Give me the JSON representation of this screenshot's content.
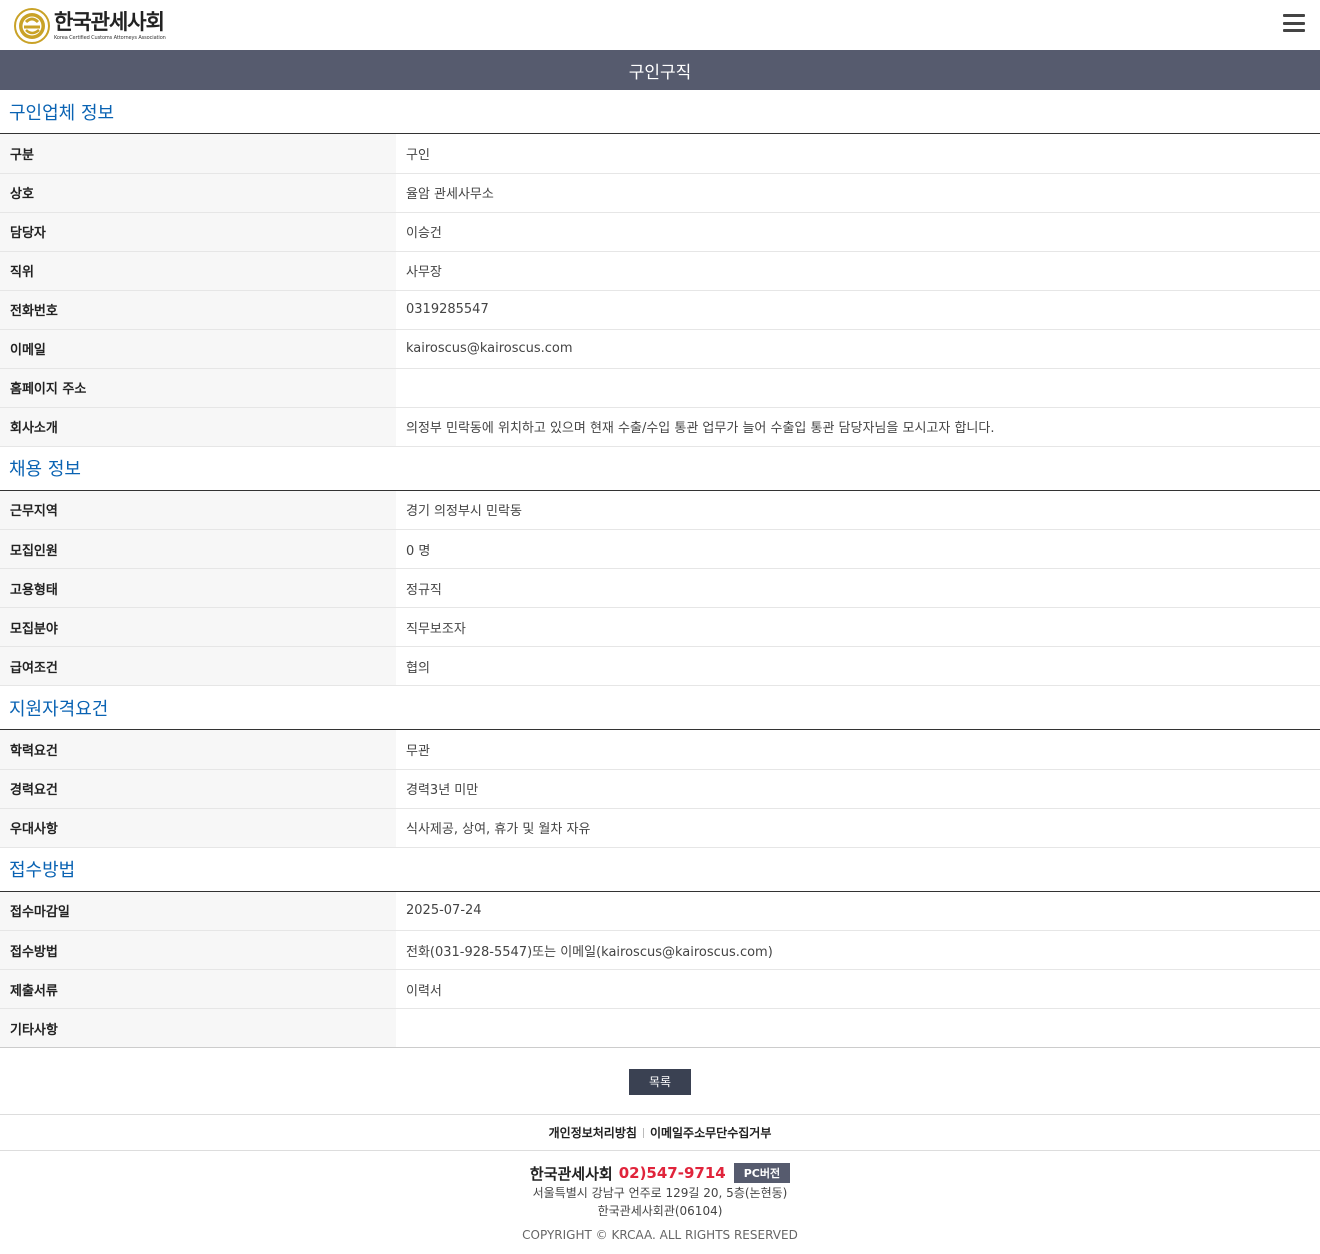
{
  "header": {
    "logo_ko": "한국관세사회",
    "logo_en": "Korea Certified Customs Attorneys Association",
    "menu_icon": "hamburger-menu-icon"
  },
  "page_title": "구인구직",
  "sections": [
    {
      "title": "구인업체 정보",
      "rows": [
        {
          "label": "구분",
          "value": "구인"
        },
        {
          "label": "상호",
          "value": "율암 관세사무소"
        },
        {
          "label": "담당자",
          "value": "이승건"
        },
        {
          "label": "직위",
          "value": "사무장"
        },
        {
          "label": "전화번호",
          "value": "0319285547"
        },
        {
          "label": "이메일",
          "value": "kairoscus@kairoscus.com"
        },
        {
          "label": "홈페이지 주소",
          "value": ""
        },
        {
          "label": "회사소개",
          "value": "의정부 민락동에 위치하고 있으며 현재 수출/수입 통관 업무가 늘어 수출입 통관 담당자님을 모시고자 합니다."
        }
      ]
    },
    {
      "title": "채용 정보",
      "rows": [
        {
          "label": "근무지역",
          "value": "경기 의정부시 민락동"
        },
        {
          "label": "모집인원",
          "value": "0 명"
        },
        {
          "label": "고용형태",
          "value": "정규직"
        },
        {
          "label": "모집분야",
          "value": "직무보조자"
        },
        {
          "label": "급여조건",
          "value": "협의"
        }
      ]
    },
    {
      "title": "지원자격요건",
      "rows": [
        {
          "label": "학력요건",
          "value": "무관"
        },
        {
          "label": "경력요건",
          "value": "경력3년 미만"
        },
        {
          "label": "우대사항",
          "value": "식사제공, 상여, 휴가 및 월차 자유"
        }
      ]
    },
    {
      "title": "접수방법",
      "rows": [
        {
          "label": "접수마감일",
          "value": "2025-07-24"
        },
        {
          "label": "접수방법",
          "value": "전화(031-928-5547)또는 이메일(kairoscus@kairoscus.com)"
        },
        {
          "label": "제출서류",
          "value": "이력서"
        },
        {
          "label": "기타사항",
          "value": ""
        }
      ]
    }
  ],
  "list_button": "목록",
  "footer_links": [
    "개인정보처리방침",
    "이메일주소무단수집거부"
  ],
  "footer": {
    "name": "한국관세사회",
    "phone": "02)547-9714",
    "pc_button": "PC버전",
    "address1": "서울특별시 강남구 언주로 129길 20, 5층(논현동)",
    "address2": "한국관세사회관(06104)",
    "copyright": "COPYRIGHT © KRCAA. ALL RIGHTS RESERVED"
  },
  "colors": {
    "title_bar": "#565b6e",
    "section_title": "#0a63b3",
    "button": "#3a4152",
    "phone": "#e0243b",
    "logo_gold": "#c9a227"
  }
}
